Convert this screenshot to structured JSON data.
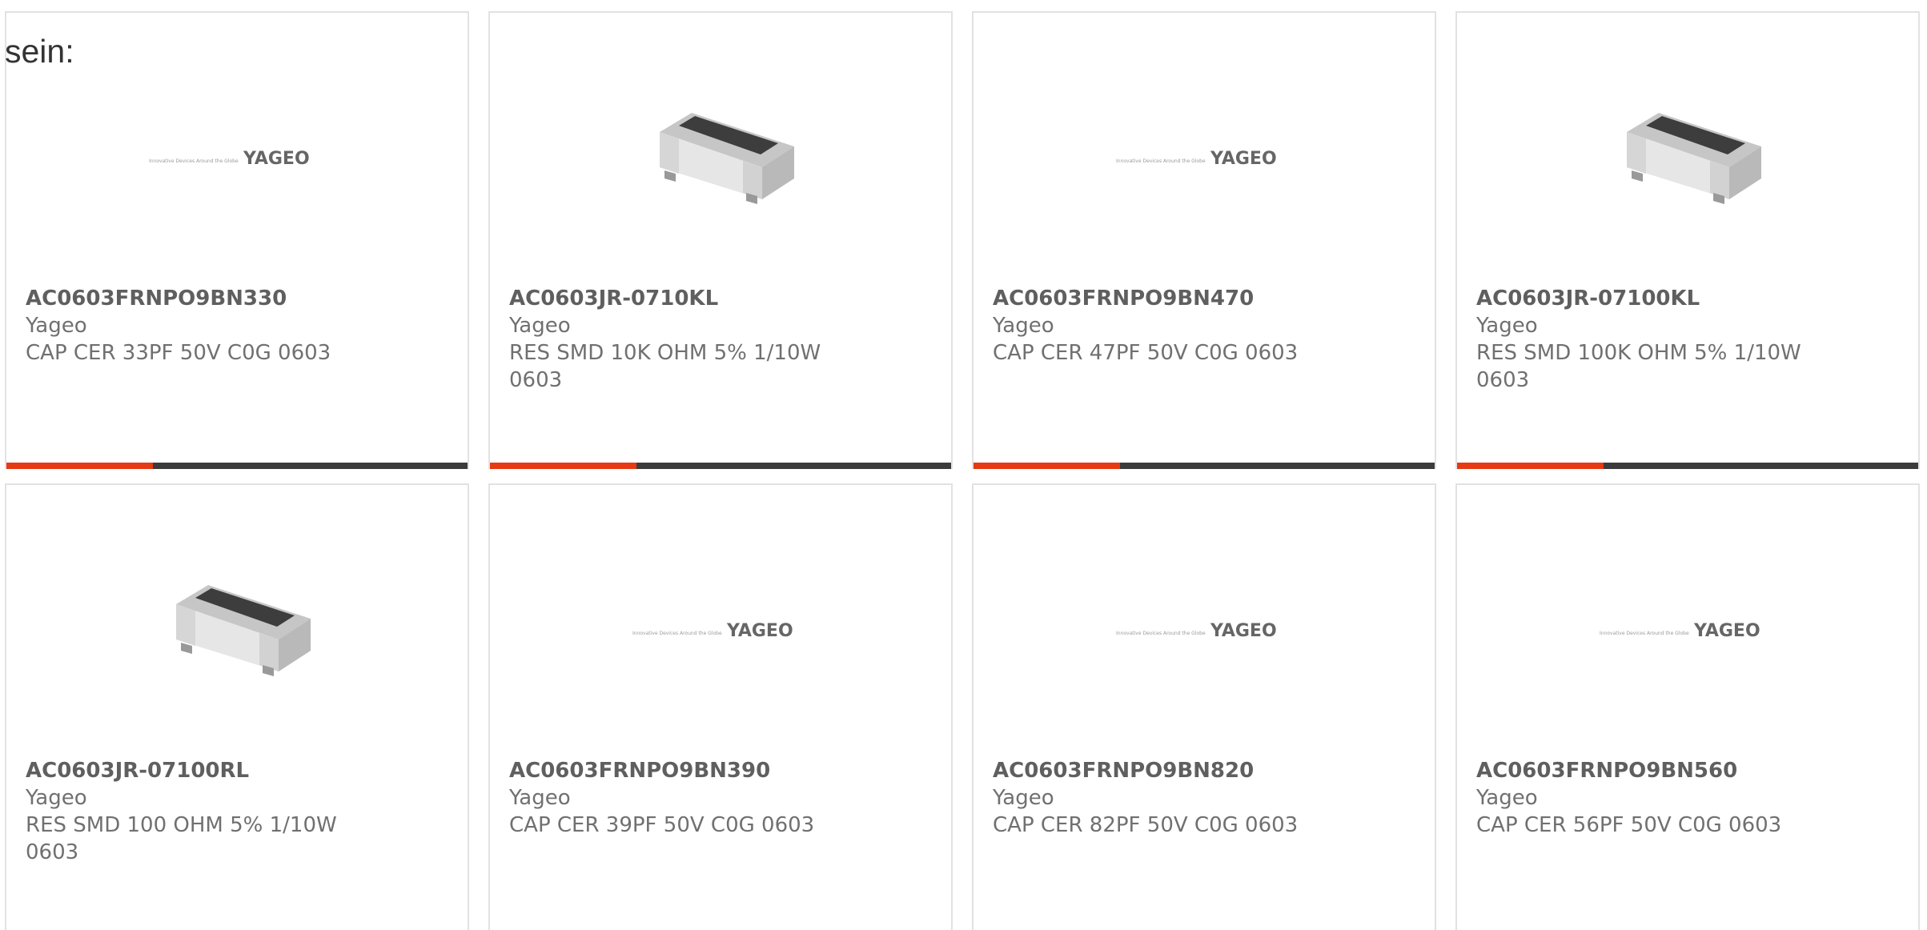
{
  "intro_text": "sein:",
  "colors": {
    "accent": "#e53a13",
    "bar": "#3b3b3b",
    "text": "#707070",
    "border": "#e2e2e2"
  },
  "products": [
    {
      "part_number": "AC0603FRNPO9BN330",
      "manufacturer": "Yageo",
      "description": "CAP CER 33PF 50V C0G 0603",
      "image": "yageo-logo"
    },
    {
      "part_number": "AC0603JR-0710KL",
      "manufacturer": "Yageo",
      "description": "RES SMD 10K OHM 5% 1/10W 0603",
      "image": "smd-resistor"
    },
    {
      "part_number": "AC0603FRNPO9BN470",
      "manufacturer": "Yageo",
      "description": "CAP CER 47PF 50V C0G 0603",
      "image": "yageo-logo"
    },
    {
      "part_number": "AC0603JR-07100KL",
      "manufacturer": "Yageo",
      "description": "RES SMD 100K OHM 5% 1/10W 0603",
      "image": "smd-resistor"
    },
    {
      "part_number": "AC0603JR-07100RL",
      "manufacturer": "Yageo",
      "description": "RES SMD 100 OHM 5% 1/10W 0603",
      "image": "smd-resistor"
    },
    {
      "part_number": "AC0603FRNPO9BN390",
      "manufacturer": "Yageo",
      "description": "CAP CER 39PF 50V C0G 0603",
      "image": "yageo-logo"
    },
    {
      "part_number": "AC0603FRNPO9BN820",
      "manufacturer": "Yageo",
      "description": "CAP CER 82PF 50V C0G 0603",
      "image": "yageo-logo"
    },
    {
      "part_number": "AC0603FRNPO9BN560",
      "manufacturer": "Yageo",
      "description": "CAP CER 56PF 50V C0G 0603",
      "image": "yageo-logo"
    }
  ],
  "logo": {
    "tagline": "Innovative Devices Around the Globe",
    "brand": "YAGEO"
  }
}
